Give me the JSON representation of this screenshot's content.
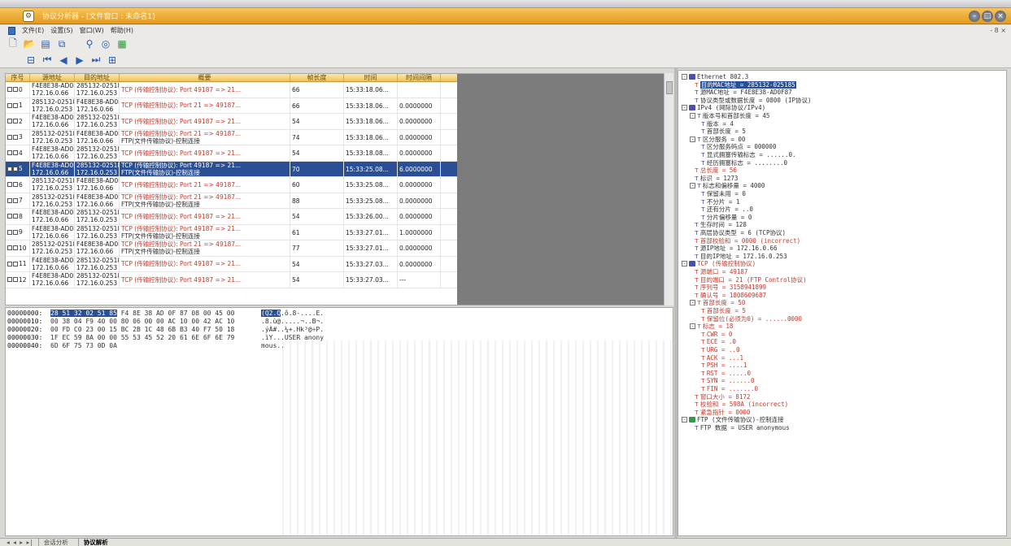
{
  "window": {
    "title": "协议分析器 - [文件窗口 : 未命名1]",
    "buttons": [
      "–",
      "□",
      "×"
    ]
  },
  "menu": {
    "items": [
      "文件(E)",
      "设置(S)",
      "窗口(W)",
      "帮助(H)"
    ],
    "mdi_controls": "- 8 ×"
  },
  "list": {
    "headers": [
      "序号",
      "源地址",
      "目的地址",
      "概要",
      "帧长度",
      "时间",
      "时间间隔"
    ],
    "rows": [
      {
        "no": "0",
        "src_mac": "F4E8E38-AD0F87",
        "src_ip": "172.16.0.66",
        "dst_mac": "285132-025185",
        "dst_ip": "172.16.0.253",
        "sum1": "TCP (传输控制协议): Port 49187 => 21...",
        "sum2": "",
        "len": "66",
        "time": "15:33:18.06...",
        "dt": ""
      },
      {
        "no": "1",
        "src_mac": "285132-025185",
        "src_ip": "172.16.0.253",
        "dst_mac": "F4E8E38-AD0F87",
        "dst_ip": "172.16.0.66",
        "sum1": "TCP (传输控制协议): Port 21 => 49187...",
        "sum2": "",
        "len": "66",
        "time": "15:33:18.06...",
        "dt": "0.0000000"
      },
      {
        "no": "2",
        "src_mac": "F4E8E38-AD0F87",
        "src_ip": "172.16.0.66",
        "dst_mac": "285132-025185",
        "dst_ip": "172.16.0.253",
        "sum1": "TCP (传输控制协议): Port 49187 => 21...",
        "sum2": "",
        "len": "54",
        "time": "15:33:18.06...",
        "dt": "0.0000000"
      },
      {
        "no": "3",
        "src_mac": "285132-025185",
        "src_ip": "172.16.0.253",
        "dst_mac": "F4E8E38-AD0F87",
        "dst_ip": "172.16.0.66",
        "sum1": "TCP (传输控制协议): Port 21 => 49187...",
        "sum2": "FTP(文件传输协议)-控制连接",
        "len": "74",
        "time": "15:33:18.06...",
        "dt": "0.0000000"
      },
      {
        "no": "4",
        "src_mac": "F4E8E38-AD0F87",
        "src_ip": "172.16.0.66",
        "dst_mac": "285132-025185",
        "dst_ip": "172.16.0.253",
        "sum1": "TCP (传输控制协议): Port 49187 => 21...",
        "sum2": "",
        "len": "54",
        "time": "15:33:18.08...",
        "dt": "0.0000000"
      },
      {
        "no": "5",
        "src_mac": "F4E8E38-AD0F87",
        "src_ip": "172.16.0.66",
        "dst_mac": "285132-025185",
        "dst_ip": "172.16.0.253",
        "sum1": "TCP (传输控制协议): Port 49187 => 21...",
        "sum2": "FTP(文件传输协议)-控制连接",
        "len": "70",
        "time": "15:33:25.08...",
        "dt": "6.0000000",
        "selected": true
      },
      {
        "no": "6",
        "src_mac": "285132-025185",
        "src_ip": "172.16.0.253",
        "dst_mac": "F4E8E38-AD0F87",
        "dst_ip": "172.16.0.66",
        "sum1": "TCP (传输控制协议): Port 21 => 49187...",
        "sum2": "",
        "len": "60",
        "time": "15:33:25.08...",
        "dt": "0.0000000"
      },
      {
        "no": "7",
        "src_mac": "285132-025185",
        "src_ip": "172.16.0.253",
        "dst_mac": "F4E8E38-AD0F87",
        "dst_ip": "172.16.0.66",
        "sum1": "TCP (传输控制协议): Port 21 => 49187...",
        "sum2": "FTP(文件传输协议)-控制连接",
        "len": "88",
        "time": "15:33:25.08...",
        "dt": "0.0000000"
      },
      {
        "no": "8",
        "src_mac": "F4E8E38-AD0F87",
        "src_ip": "172.16.0.66",
        "dst_mac": "285132-025185",
        "dst_ip": "172.16.0.253",
        "sum1": "TCP (传输控制协议): Port 49187 => 21...",
        "sum2": "",
        "len": "54",
        "time": "15:33:26.00...",
        "dt": "0.0000000"
      },
      {
        "no": "9",
        "src_mac": "F4E8E38-AD0F87",
        "src_ip": "172.16.0.66",
        "dst_mac": "285132-025185",
        "dst_ip": "172.16.0.253",
        "sum1": "TCP (传输控制协议): Port 49187 => 21...",
        "sum2": "FTP(文件传输协议)-控制连接",
        "len": "61",
        "time": "15:33:27.01...",
        "dt": "1.0000000"
      },
      {
        "no": "10",
        "src_mac": "285132-025185",
        "src_ip": "172.16.0.253",
        "dst_mac": "F4E8E38-AD0F87",
        "dst_ip": "172.16.0.66",
        "sum1": "TCP (传输控制协议): Port 21 => 49187...",
        "sum2": "FTP(文件传输协议)-控制连接",
        "len": "77",
        "time": "15:33:27.01...",
        "dt": "0.0000000"
      },
      {
        "no": "11",
        "src_mac": "F4E8E38-AD0F87",
        "src_ip": "172.16.0.66",
        "dst_mac": "285132-025185",
        "dst_ip": "172.16.0.253",
        "sum1": "TCP (传输控制协议): Port 49187 => 21...",
        "sum2": "",
        "len": "54",
        "time": "15:33:27.03...",
        "dt": "0.0000000"
      },
      {
        "no": "12",
        "src_mac": "F4E8E38-AD0F87",
        "src_ip": "172.16.0.66",
        "dst_mac": "285132-025185",
        "dst_ip": "172.16.0.253",
        "sum1": "TCP (传输控制协议): Port 49187 => 21...",
        "sum2": "",
        "len": "54",
        "time": "15:33:27.03...",
        "dt": "---"
      }
    ]
  },
  "hex": {
    "offsets": [
      "00000000:",
      "00000010:",
      "00000020:",
      "00000030:",
      "00000040:"
    ],
    "lines": [
      {
        "hl": "28 51 32 02 51 85",
        "rest": " F4 8E 38 AD 0F 87 08 00 45 00",
        "ascii_hl": "(Q2.Q",
        "ascii_rest": ".ô.8-....E."
      },
      {
        "hl": "",
        "rest": "00 38 04 F9 40 00 80 06 00 00 AC 10 00 42 AC 10",
        "ascii_hl": "",
        "ascii_rest": ".8.ù@.....¬..B¬."
      },
      {
        "hl": "",
        "rest": "00 FD C0 23 00 15 BC 2B 1C 48 6B B3 40 F7 50 18",
        "ascii_hl": "",
        "ascii_rest": ".ýÀ#..¼+.Hk³@÷P."
      },
      {
        "hl": "",
        "rest": "1F EC 59 8A 00 00 55 53 45 52 20 61 6E 6F 6E 79",
        "ascii_hl": "",
        "ascii_rest": ".ìY...USER anony"
      },
      {
        "hl": "",
        "rest": "6D 6F 75 73 0D 0A",
        "ascii_hl": "",
        "ascii_rest": "mous.."
      }
    ]
  },
  "tree": [
    {
      "text": "Ethernet 802.3",
      "type": "group",
      "box": "-"
    },
    {
      "text": "目的MAC地址 = 285132-025185",
      "type": "leaf",
      "red": true,
      "sel": true
    },
    {
      "text": "源MAC地址 = F4E8E38-AD0F87",
      "type": "leaf",
      "red": false
    },
    {
      "text": "协议类型或数据长度 = 0800 (IP协议)",
      "type": "leaf",
      "red": false
    },
    {
      "text": "IPv4 (网际协议/IPv4)",
      "type": "group",
      "box": "-"
    },
    {
      "text": "版本号和首部长度 = 45",
      "type": "sub",
      "box": "-"
    },
    {
      "text": "版本 = 4",
      "type": "leaf2",
      "red": false
    },
    {
      "text": "首部长度 = 5",
      "type": "leaf2",
      "red": false
    },
    {
      "text": "区分服务 = 00",
      "type": "sub",
      "box": "-"
    },
    {
      "text": "区分服务码点 = 000000",
      "type": "leaf2",
      "red": false
    },
    {
      "text": "显式拥塞传输标志 = ......0.",
      "type": "leaf2",
      "red": false
    },
    {
      "text": "经历拥塞标志 = ........0",
      "type": "leaf2",
      "red": false
    },
    {
      "text": "总长度 = 56",
      "type": "leaf",
      "red": true
    },
    {
      "text": "标识 = 1273",
      "type": "leaf",
      "red": false
    },
    {
      "text": "标志和偏移量 = 4000",
      "type": "sub",
      "box": "-"
    },
    {
      "text": "保留未用 = 0",
      "type": "leaf2",
      "red": false
    },
    {
      "text": "不分片 = 1",
      "type": "leaf2",
      "red": false
    },
    {
      "text": "还有分片 = ..0",
      "type": "leaf2",
      "red": false
    },
    {
      "text": "分片偏移量 = 0",
      "type": "leaf2",
      "red": false
    },
    {
      "text": "生存时间 = 128",
      "type": "leaf",
      "red": false
    },
    {
      "text": "高层协议类型 = 6 (TCP协议)",
      "type": "leaf",
      "red": false
    },
    {
      "text": "首部校验和 = 0000 (incorrect)",
      "type": "leaf",
      "red": true
    },
    {
      "text": "源IP地址 = 172.16.0.66",
      "type": "leaf",
      "red": false
    },
    {
      "text": "目的IP地址 = 172.16.0.253",
      "type": "leaf",
      "red": false
    },
    {
      "text": "TCP (传输控制协议)",
      "type": "group",
      "box": "-",
      "red": true
    },
    {
      "text": "源端口 = 49187",
      "type": "leaf",
      "red": true
    },
    {
      "text": "目的端口 = 21 (FTP Control协议)",
      "type": "leaf",
      "red": true
    },
    {
      "text": "序列号 = 3158941899",
      "type": "leaf",
      "red": true
    },
    {
      "text": "确认号 = 1808609687",
      "type": "leaf",
      "red": true
    },
    {
      "text": "首部长度 = 50",
      "type": "sub",
      "box": "-",
      "red": true
    },
    {
      "text": "首部长度 = 5",
      "type": "leaf2",
      "red": true
    },
    {
      "text": "保留位(必须为0) = ......0000",
      "type": "leaf2",
      "red": true
    },
    {
      "text": "标志 = 18",
      "type": "sub",
      "box": "-",
      "red": true
    },
    {
      "text": "CWR = 0",
      "type": "leaf2",
      "red": true
    },
    {
      "text": "ECE = .0",
      "type": "leaf2",
      "red": true
    },
    {
      "text": "URG = ..0",
      "type": "leaf2",
      "red": true
    },
    {
      "text": "ACK = ...1",
      "type": "leaf2",
      "red": true
    },
    {
      "text": "PSH = ....1",
      "type": "leaf2",
      "red": true
    },
    {
      "text": "RST = .....0",
      "type": "leaf2",
      "red": true
    },
    {
      "text": "SYN = ......0",
      "type": "leaf2",
      "red": true
    },
    {
      "text": "FIN = .......0",
      "type": "leaf2",
      "red": true
    },
    {
      "text": "窗口大小 = 8172",
      "type": "leaf",
      "red": true
    },
    {
      "text": "校验和 = 598A (incorrect)",
      "type": "leaf",
      "red": true
    },
    {
      "text": "紧急指针 = 0000",
      "type": "leaf",
      "red": true
    },
    {
      "text": "FTP (文件传输协议)-控制连接",
      "type": "group",
      "box": "-",
      "ftp": true
    },
    {
      "text": "FTP 数据 = USER anonymous",
      "type": "leaf",
      "red": false
    }
  ],
  "tabs": {
    "nav": "◂ ◂ ▸ ▸|",
    "items": [
      "会话分析",
      "协议解析"
    ],
    "active": 1
  },
  "colors": {
    "title_bar": "#e39a1e",
    "selection": "#2a4f94",
    "alert_text": "#c0392b",
    "list_header": "#f0c35a"
  }
}
